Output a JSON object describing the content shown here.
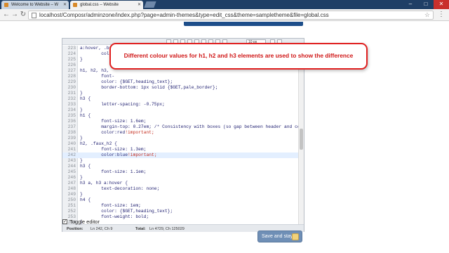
{
  "browser": {
    "tabs": [
      {
        "title": "Welcome to Website – W"
      },
      {
        "title": "global.css – Website"
      }
    ],
    "url": "localhost/Composr/adminzone/index.php?page=admin-themes&type=edit_css&theme=sampletheme&file=global.css"
  },
  "editor": {
    "font_size_value": "10 px",
    "lines": [
      {
        "num": "223",
        "code": "a:hover, .button_hyperlink:hover {"
      },
      {
        "num": "224",
        "code": "        color:"
      },
      {
        "num": "225",
        "code": "}"
      },
      {
        "num": "226",
        "code": ""
      },
      {
        "num": "227",
        "code": "h1, h2, h3,"
      },
      {
        "num": "228",
        "code": "        font-"
      },
      {
        "num": "229",
        "code": "        color: {$GET,heading_text};"
      },
      {
        "num": "230",
        "code": "        border-bottom: 1px solid {$GET,pale_border};"
      },
      {
        "num": "231",
        "code": "}"
      },
      {
        "num": "232",
        "code": "h3 {"
      },
      {
        "num": "233",
        "code": "        letter-spacing: -0.75px;"
      },
      {
        "num": "234",
        "code": "}"
      },
      {
        "num": "235",
        "code": "h1 {"
      },
      {
        "num": "236",
        "code": "        font-size: 1.6em;"
      },
      {
        "num": "237",
        "code": "        margin-top: 0.27em; /* Consistency with boxes (so gap between header and cont"
      },
      {
        "num": "238",
        "code": "        color:red!important;"
      },
      {
        "num": "239",
        "code": "}"
      },
      {
        "num": "240",
        "code": "h2, .faux_h2 {"
      },
      {
        "num": "241",
        "code": "        font-size: 1.3em;"
      },
      {
        "num": "242",
        "code": "        color:blue!important;"
      },
      {
        "num": "243",
        "code": "}"
      },
      {
        "num": "244",
        "code": "h3 {"
      },
      {
        "num": "245",
        "code": "        font-size: 1.1em;"
      },
      {
        "num": "246",
        "code": "}"
      },
      {
        "num": "247",
        "code": "h3 a, h3 a:hover {"
      },
      {
        "num": "248",
        "code": "        text-decoration: none;"
      },
      {
        "num": "249",
        "code": "}"
      },
      {
        "num": "250",
        "code": "h4 {"
      },
      {
        "num": "251",
        "code": "        font-size: 1em;"
      },
      {
        "num": "252",
        "code": "        color: {$GET,heading_text};"
      },
      {
        "num": "253",
        "code": "        font-weight: bold;"
      },
      {
        "num": "254",
        "code": "}"
      }
    ],
    "current_line_index": 19,
    "status": {
      "position_label": "Position:",
      "position_value": "Ln 242, Ch 9",
      "total_label": "Total:",
      "total_value": "Ln 4729, Ch 125029"
    }
  },
  "toggle_editor": {
    "label": "Toggle editor",
    "checked": true
  },
  "save_button": {
    "label": "Save and stay"
  },
  "callout": {
    "text": "Different colour values for h1, h2 and h3 elements are used to show the difference"
  },
  "colors": {
    "accent": "#6f8fb6",
    "callout_border": "#e02020",
    "callout_text": "#d01818"
  }
}
